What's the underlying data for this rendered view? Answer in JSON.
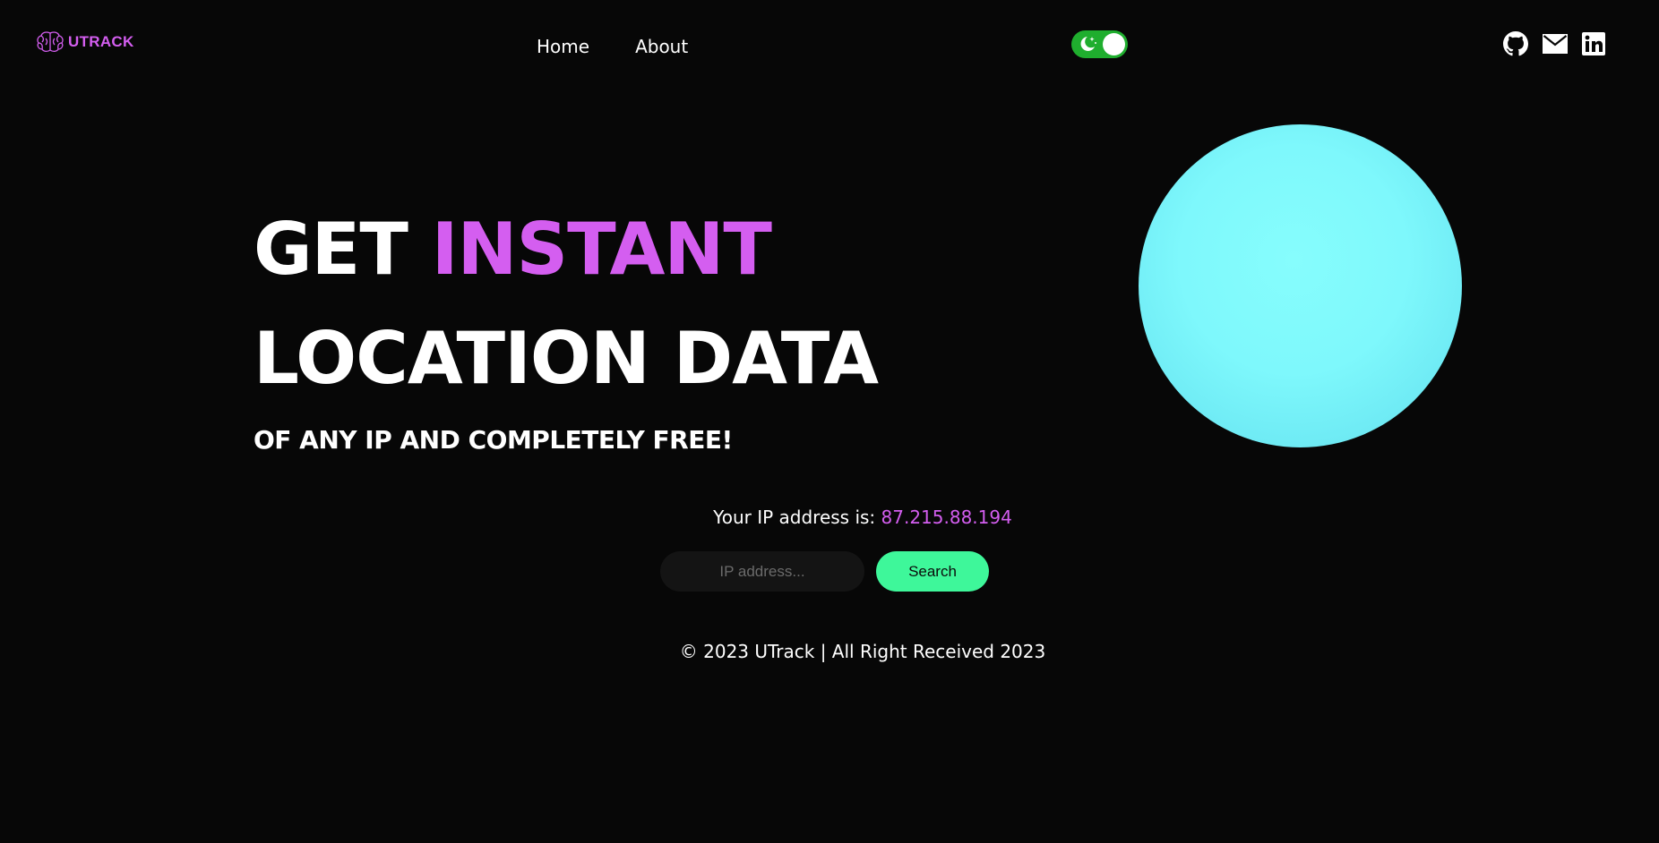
{
  "header": {
    "logo_text": "UTRACK",
    "logo_icon": "brain-icon",
    "nav": [
      {
        "label": "Home"
      },
      {
        "label": "About"
      }
    ],
    "theme_toggle": {
      "state": "dark",
      "icon": "moon-stars-icon"
    },
    "socials": [
      {
        "icon": "github-icon"
      },
      {
        "icon": "mail-icon"
      },
      {
        "icon": "linkedin-icon"
      }
    ]
  },
  "hero": {
    "title_part1": "GET",
    "title_accent": "INSTANT",
    "title_line2": "LOCATION DATA",
    "subtitle": "OF ANY IP AND COMPLETELY FREE!"
  },
  "ip": {
    "label": "Your IP address is:",
    "value": "87.215.88.194"
  },
  "search": {
    "placeholder": "IP address...",
    "value": "",
    "button_label": "Search"
  },
  "footer": {
    "text": "© 2023 UTrack | All Right Received 2023"
  },
  "colors": {
    "background": "#070707",
    "accent": "#d45ef0",
    "button": "#3ef79a",
    "toggle": "#1fae2e",
    "sphere": "#7ef8fc"
  }
}
